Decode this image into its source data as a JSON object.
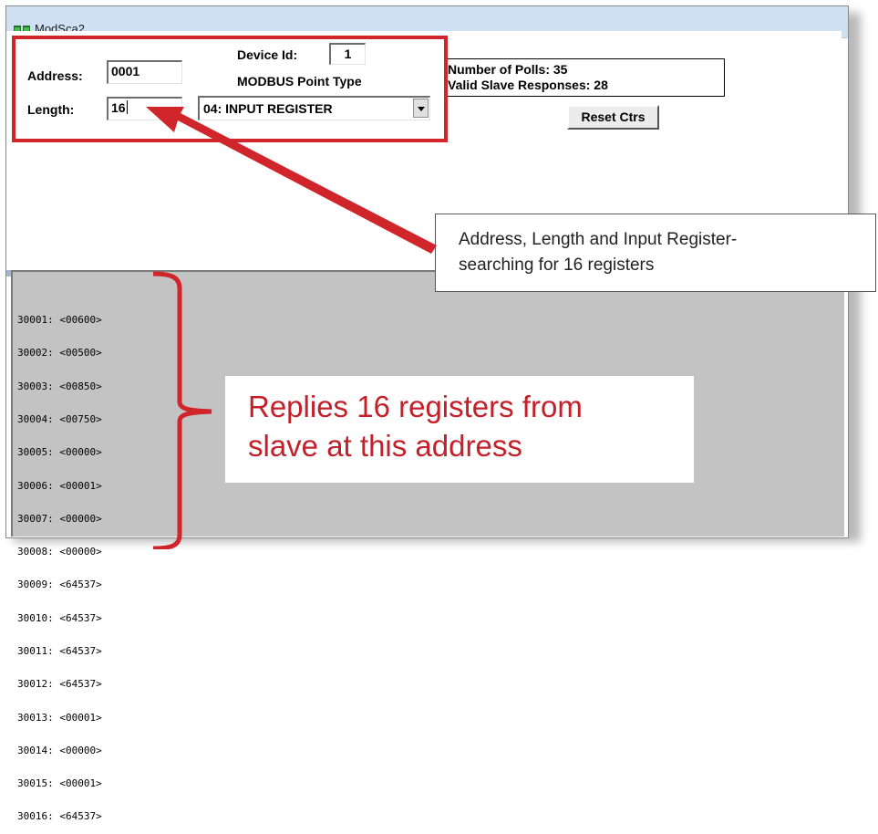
{
  "window": {
    "title": "ModSca2"
  },
  "form": {
    "address_label": "Address:",
    "address_value": "0001",
    "length_label": "Length:",
    "length_value": "16",
    "device_id_label": "Device Id:",
    "device_id_value": "1",
    "point_type_label": "MODBUS Point Type",
    "point_type_value": "04: INPUT REGISTER"
  },
  "stats": {
    "polls": "Number of Polls: 35",
    "valid_responses": "Valid Slave Responses: 28",
    "reset_label": "Reset Ctrs"
  },
  "registers": [
    "30001: <00600>",
    "30002: <00500>",
    "30003: <00850>",
    "30004: <00750>",
    "30005: <00000>",
    "30006: <00001>",
    "30007: <00000>",
    "30008: <00000>",
    "30009: <64537>",
    "30010: <64537>",
    "30011: <64537>",
    "30012: <64537>",
    "30013: <00001>",
    "30014: <00000>",
    "30015: <00001>",
    "30016: <64537>"
  ],
  "annotations": {
    "callout_top_line1": "Address, Length  and Input Register-",
    "callout_top_line2": "searching for 16 registers",
    "callout_bottom_line1": "Replies 16 registers from",
    "callout_bottom_line2": "slave at this address"
  },
  "colors": {
    "annotation_red": "#d0252b",
    "panel_gray": "#c3c3c3",
    "titlebar": "#cfe0f3"
  }
}
